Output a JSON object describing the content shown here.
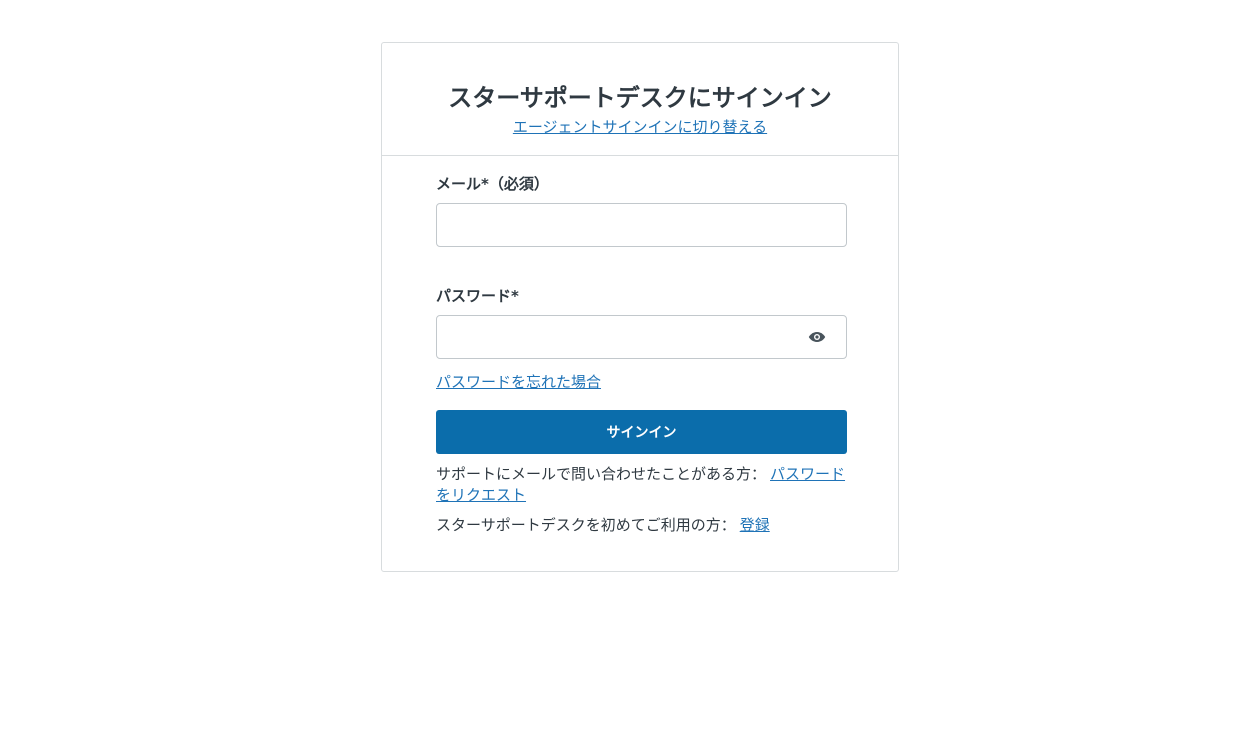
{
  "header": {
    "title": "スターサポートデスクにサインイン",
    "switch_link": "エージェントサインインに切り替える"
  },
  "form": {
    "email_label": "メール*（必須）",
    "email_value": "",
    "password_label": "パスワード*",
    "password_value": "",
    "forgot_link": "パスワードを忘れた場合",
    "submit_label": "サインイン"
  },
  "footer": {
    "request_text": "サポートにメールで問い合わせたことがある方：",
    "request_link": "パスワードをリクエスト",
    "register_text": "スターサポートデスクを初めてご利用の方：",
    "register_link": "登録"
  },
  "icons": {
    "password_toggle": "eye-icon"
  },
  "colors": {
    "primary_button": "#0b6dab",
    "link": "#1f73b7",
    "text": "#2f3941",
    "border": "#d8dcde"
  }
}
